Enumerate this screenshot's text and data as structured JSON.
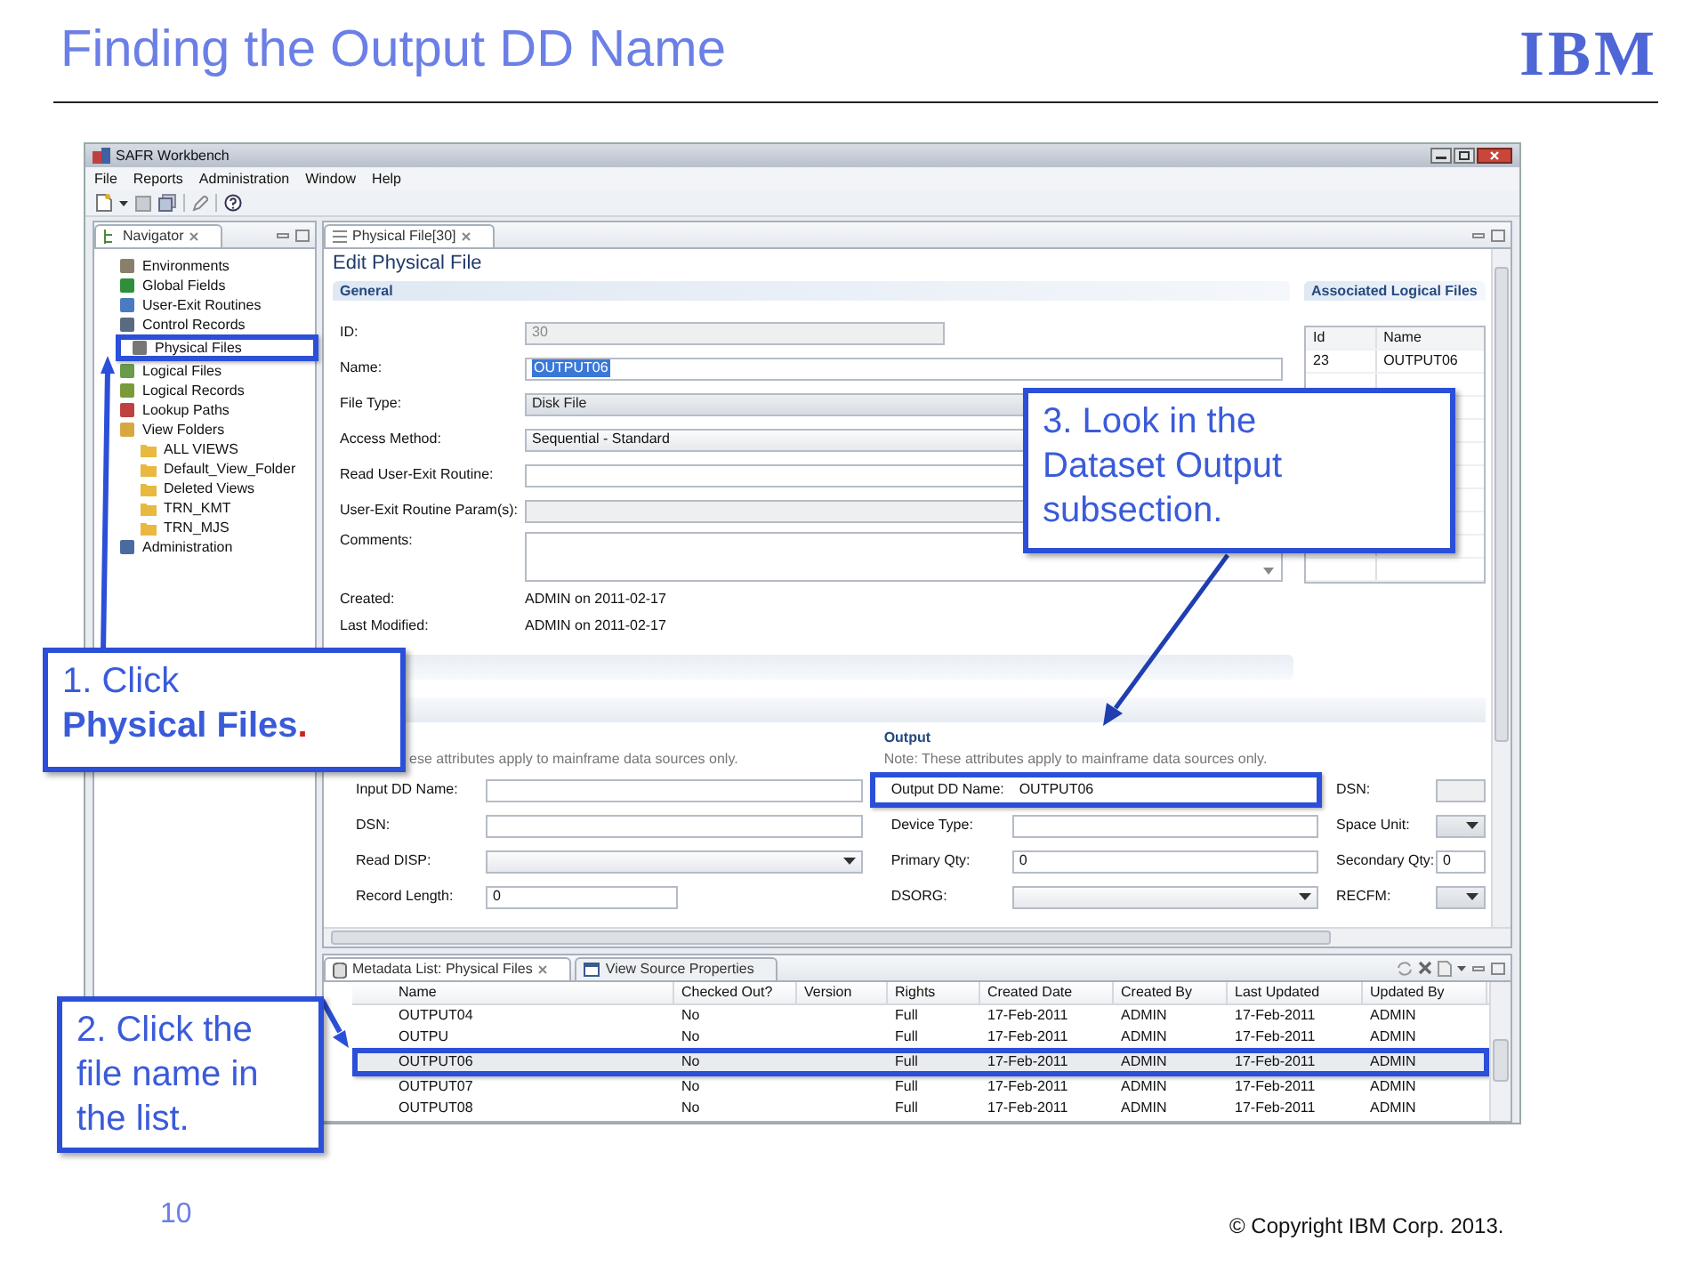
{
  "slide": {
    "title": "Finding the Output DD Name",
    "logo": "IBM",
    "page_number": "10",
    "copyright": "© Copyright  IBM Corp. 2013."
  },
  "window": {
    "title": "SAFR Workbench"
  },
  "menu": [
    "File",
    "Reports",
    "Administration",
    "Window",
    "Help"
  ],
  "navigator": {
    "tab": "Navigator",
    "items": [
      {
        "label": "Environments",
        "highlighted": false
      },
      {
        "label": "Global Fields",
        "highlighted": false
      },
      {
        "label": "User-Exit Routines",
        "highlighted": false
      },
      {
        "label": "Control Records",
        "highlighted": false
      },
      {
        "label": "Physical Files",
        "highlighted": true
      },
      {
        "label": "Logical Files",
        "highlighted": false
      },
      {
        "label": "Logical Records",
        "highlighted": false
      },
      {
        "label": "Lookup Paths",
        "highlighted": false
      },
      {
        "label": "View Folders",
        "highlighted": false,
        "children": [
          {
            "label": "ALL VIEWS",
            "highlighted": false
          },
          {
            "label": "Default_View_Folder",
            "highlighted": false
          },
          {
            "label": "Deleted Views",
            "highlighted": false
          },
          {
            "label": "TRN_KMT",
            "highlighted": false
          },
          {
            "label": "TRN_MJS",
            "highlighted": false
          }
        ]
      },
      {
        "label": "Administration",
        "highlighted": false
      }
    ]
  },
  "editor": {
    "tab": "Physical File[30]",
    "heading": "Edit Physical File",
    "general": {
      "title": "General",
      "fields": [
        {
          "label": "ID:",
          "kind": "short_text",
          "value": "30",
          "disabled": true,
          "text_selected": false
        },
        {
          "label": "Name:",
          "kind": "text",
          "value": "OUTPUT06",
          "disabled": false,
          "text_selected": true
        },
        {
          "label": "File Type:",
          "kind": "dropdown",
          "value": "Disk File",
          "disabled": true
        },
        {
          "label": "Access Method:",
          "kind": "dropdown",
          "value": "Sequential - Standard",
          "disabled": false
        },
        {
          "label": "Read User-Exit Routine:",
          "kind": "text",
          "disabled": false
        },
        {
          "label": "User-Exit Routine Param(s):",
          "kind": "text",
          "disabled": true
        },
        {
          "label": "Comments:",
          "kind": "textarea",
          "disabled": false
        },
        {
          "label": "Created:",
          "kind": "static",
          "value": "ADMIN on 2011-02-17"
        },
        {
          "label": "Last Modified:",
          "kind": "static",
          "value": "ADMIN on 2011-02-17"
        }
      ]
    },
    "associated": {
      "title": "Associated Logical Files",
      "columns": [
        "Id",
        "Name"
      ],
      "rows": [
        [
          "23",
          "OUTPUT06"
        ]
      ]
    },
    "input": {
      "note": "ese attributes apply to mainframe data sources only.",
      "fields": [
        {
          "label": "Input DD Name:",
          "kind": "text",
          "disabled": false
        },
        {
          "label": "DSN:",
          "kind": "text",
          "disabled": false
        },
        {
          "label": "Read DISP:",
          "kind": "dropdown",
          "disabled": false
        },
        {
          "label": "Record Length:",
          "kind": "short_text",
          "value": "0",
          "disabled": false,
          "text_selected": false
        }
      ]
    },
    "output": {
      "title": "Output",
      "note": "Note: These attributes apply to mainframe data sources only.",
      "fields": [
        {
          "label": "Output DD Name:",
          "kind": "text",
          "value": "OUTPUT06",
          "disabled": false,
          "text_selected": false,
          "highlighted": true
        },
        {
          "label": "Device Type:",
          "kind": "text",
          "disabled": false,
          "highlighted": false
        },
        {
          "label": "Primary Qty:",
          "kind": "text",
          "value": "0",
          "disabled": false,
          "text_selected": false,
          "highlighted": false
        },
        {
          "label": "DSORG:",
          "kind": "dropdown",
          "disabled": false,
          "highlighted": false
        }
      ]
    },
    "column_3": {
      "fields": [
        {
          "label": "DSN:",
          "kind": "text",
          "disabled": true
        },
        {
          "label": "Space Unit:",
          "kind": "dropdown",
          "disabled": true
        },
        {
          "label": "Secondary Qty:",
          "kind": "text",
          "value": "0",
          "disabled": false,
          "text_selected": false
        },
        {
          "label": "RECFM:",
          "kind": "dropdown",
          "disabled": true
        }
      ]
    }
  },
  "metadata_list": {
    "tabs": [
      {
        "label": "Metadata List: Physical Files",
        "selected": true
      },
      {
        "label": "View Source Properties",
        "selected": false
      }
    ],
    "columns": [
      "Name",
      "Checked Out?",
      "Version",
      "Rights",
      "Created Date",
      "Created By",
      "Last Updated",
      "Updated By"
    ],
    "rows": [
      {
        "name": "OUTPUT04",
        "checked_out": "No",
        "rights": "Full",
        "created_date": "17-Feb-2011",
        "created_by": "ADMIN",
        "last_updated": "17-Feb-2011",
        "updated_by": "ADMIN",
        "selected": false,
        "highlighted": false
      },
      {
        "name": "OUTPU",
        "checked_out": "No",
        "rights": "Full",
        "created_date": "17-Feb-2011",
        "created_by": "ADMIN",
        "last_updated": "17-Feb-2011",
        "updated_by": "ADMIN",
        "selected": false,
        "highlighted": false
      },
      {
        "name": "OUTPUT06",
        "checked_out": "No",
        "rights": "Full",
        "created_date": "17-Feb-2011",
        "created_by": "ADMIN",
        "last_updated": "17-Feb-2011",
        "updated_by": "ADMIN",
        "selected": true,
        "highlighted": true
      },
      {
        "name": "OUTPUT07",
        "checked_out": "No",
        "rights": "Full",
        "created_date": "17-Feb-2011",
        "created_by": "ADMIN",
        "last_updated": "17-Feb-2011",
        "updated_by": "ADMIN",
        "selected": false,
        "highlighted": false
      },
      {
        "name": "OUTPUT08",
        "checked_out": "No",
        "rights": "Full",
        "created_date": "17-Feb-2011",
        "created_by": "ADMIN",
        "last_updated": "17-Feb-2011",
        "updated_by": "ADMIN",
        "selected": false,
        "highlighted": false
      }
    ]
  },
  "callouts": [
    {
      "kind": "emphasis",
      "lead": "1. Click",
      "target": "Physical Files",
      "end": "."
    },
    {
      "kind": "plain",
      "text": "2. Click the\nfile name in\nthe list."
    },
    {
      "kind": "plain",
      "text": "3. Look in the\nDataset Output\nsubsection."
    }
  ]
}
